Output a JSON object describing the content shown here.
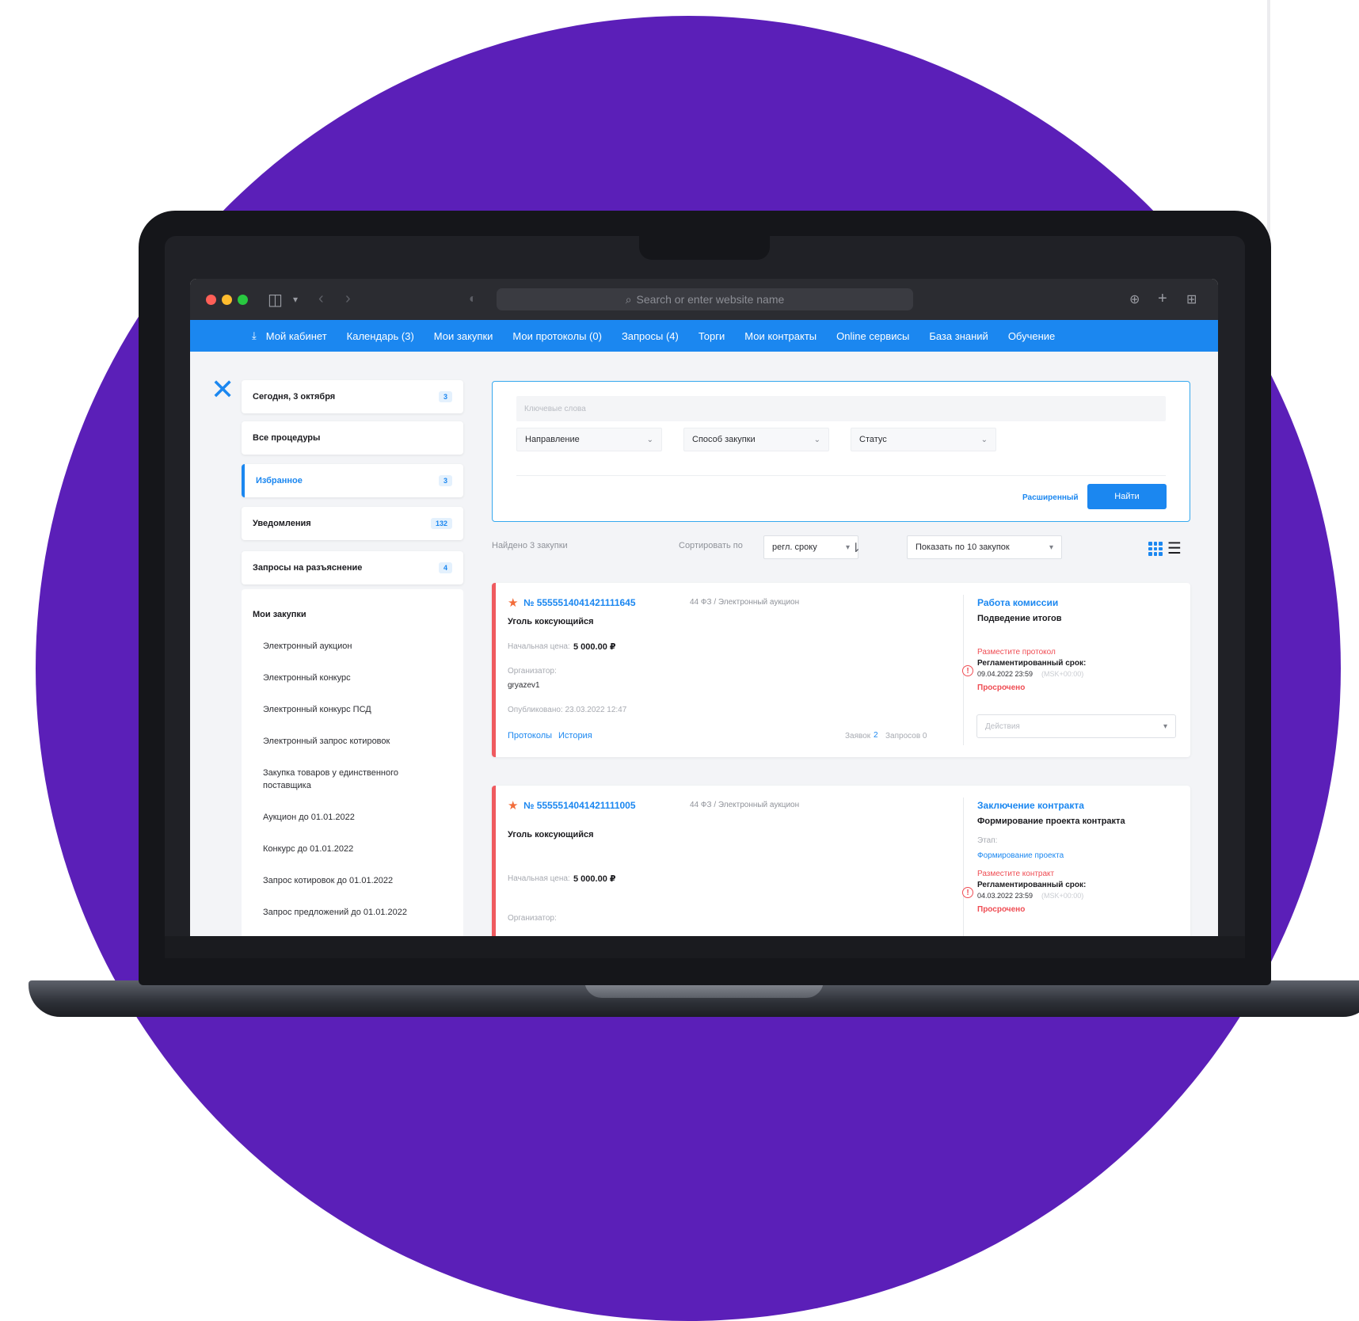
{
  "browser": {
    "url_placeholder": "Search or enter website name"
  },
  "nav": {
    "items": [
      "Мой кабинет",
      "Календарь (3)",
      "Мои закупки",
      "Мои протоколы (0)",
      "Запросы (4)",
      "Торги",
      "Мои контракты",
      "Online сервисы",
      "База знаний",
      "Обучение"
    ]
  },
  "sidebar": {
    "cards": [
      {
        "label": "Сегодня, 3 октября",
        "badge": "3"
      },
      {
        "label": "Все процедуры",
        "badge": ""
      },
      {
        "label": "Избранное",
        "badge": "3"
      },
      {
        "label": "Уведомления",
        "badge": "132"
      },
      {
        "label": "Запросы на разъяснение",
        "badge": "4"
      }
    ],
    "list_title": "Мои закупки",
    "list_items": [
      "Электронный аукцион",
      "Электронный конкурс",
      "Электронный конкурс ПСД",
      "Электронный запрос котировок",
      "Закупка товаров у единственного поставщика",
      "Аукцион до 01.01.2022",
      "Конкурс до 01.01.2022",
      "Запрос котировок до 01.01.2022",
      "Запрос предложений до 01.01.2022"
    ]
  },
  "filters": {
    "keywords_placeholder": "Ключевые слова",
    "direction": "Направление",
    "method": "Способ закупки",
    "status": "Статус",
    "extended_label": "Расширенный",
    "find_label": "Найти"
  },
  "results": {
    "found_text": "Найдено 3 закупки",
    "sort_label": "Сортировать по",
    "sort_value": "регл. сроку",
    "page_size": "Показать по 10 закупок"
  },
  "cards": [
    {
      "number": "№ 5555514041421111645",
      "law": "44 ФЗ / Электронный аукцион",
      "name": "Уголь коксующийся",
      "price_label": "Начальная цена:",
      "price_value": "5 000.00 ₽",
      "organizer_label": "Организатор:",
      "organizer_value": "gryazev1",
      "published": "Опубликовано: 23.03.2022 12:47",
      "link_protocols": "Протоколы",
      "link_history": "История",
      "bids_label": "Заявок",
      "bids_count": "2",
      "requests_label": "Запросов 0",
      "status_title": "Работа комиссии",
      "status_sub": "Подведение итогов",
      "warning": "Разместите протокол",
      "deadline_label": "Регламентированный срок:",
      "deadline_value": "09.04.2022 23:59",
      "deadline_tz": "(MSK+00:00)",
      "overdue": "Просрочено",
      "actions_placeholder": "Действия"
    },
    {
      "number": "№ 5555514041421111005",
      "law": "44 ФЗ / Электронный аукцион",
      "name": "Уголь коксующийся",
      "price_label": "Начальная цена:",
      "price_value": "5 000.00 ₽",
      "organizer_label": "Организатор:",
      "status_title": "Заключение контракта",
      "status_sub": "Формирование проекта контракта",
      "stage_label": "Этап:",
      "stage_value": "Формирование проекта",
      "warning": "Разместите контракт",
      "deadline_label": "Регламентированный срок:",
      "deadline_value": "04.03.2022 23:59",
      "deadline_tz": "(MSK+00:00)",
      "overdue": "Просрочено"
    }
  ],
  "colors": {
    "background_circle": "#5b1fb8",
    "nav_blue": "#1b87f0",
    "accent_red": "#ef5a5f",
    "star_orange": "#f26c3a"
  }
}
